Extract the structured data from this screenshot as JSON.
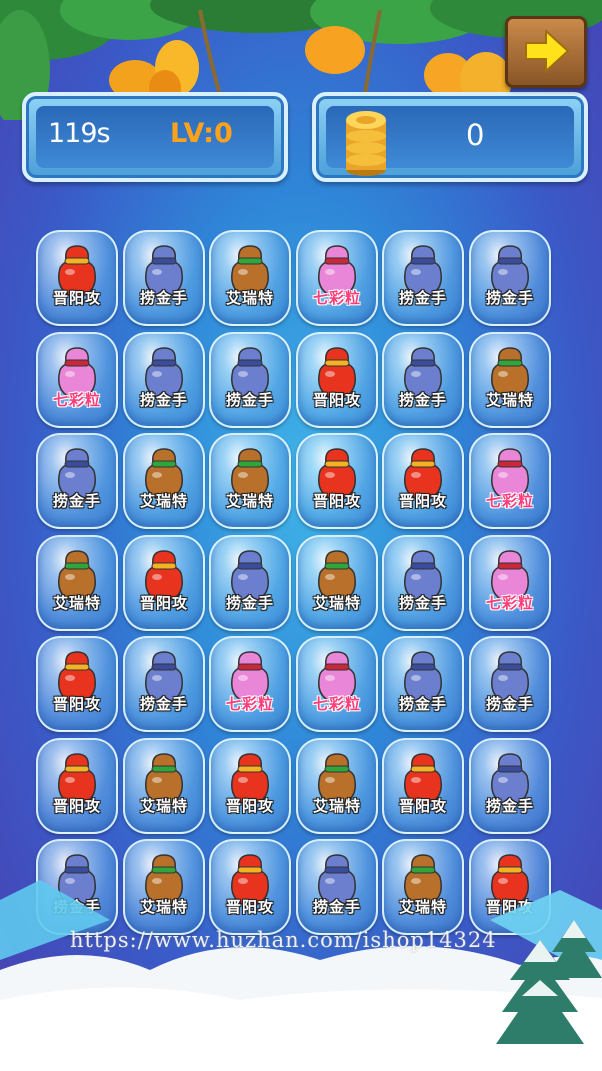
{
  "hud": {
    "timer": "119s",
    "level": "LV:0",
    "score": "0"
  },
  "next_button": {
    "icon": "arrow-right-icon"
  },
  "tile_types": {
    "red": {
      "label": "晋阳攻",
      "bag_color": "#e8341f",
      "accent": "#f5b324"
    },
    "blue": {
      "label": "捞金手",
      "bag_color": "#6c7fcf",
      "accent": "#3a4d9c"
    },
    "brown": {
      "label": "艾瑞特",
      "bag_color": "#b8702a",
      "accent": "#2fa53b"
    },
    "pink": {
      "label": "七彩粒",
      "bag_color": "#e986d8",
      "accent": "#c8283a"
    }
  },
  "board": [
    [
      "red",
      "blue",
      "brown",
      "pink",
      "blue",
      "blue"
    ],
    [
      "pink",
      "blue",
      "blue",
      "red",
      "blue",
      "brown"
    ],
    [
      "blue",
      "brown",
      "brown",
      "red",
      "red",
      "pink"
    ],
    [
      "brown",
      "red",
      "blue",
      "brown",
      "blue",
      "pink"
    ],
    [
      "red",
      "blue",
      "pink",
      "pink",
      "blue",
      "blue"
    ],
    [
      "red",
      "brown",
      "red",
      "brown",
      "red",
      "blue"
    ],
    [
      "blue",
      "brown",
      "red",
      "blue",
      "brown",
      "red"
    ]
  ],
  "watermark": "https://www.huzhan.com/ishop14324"
}
